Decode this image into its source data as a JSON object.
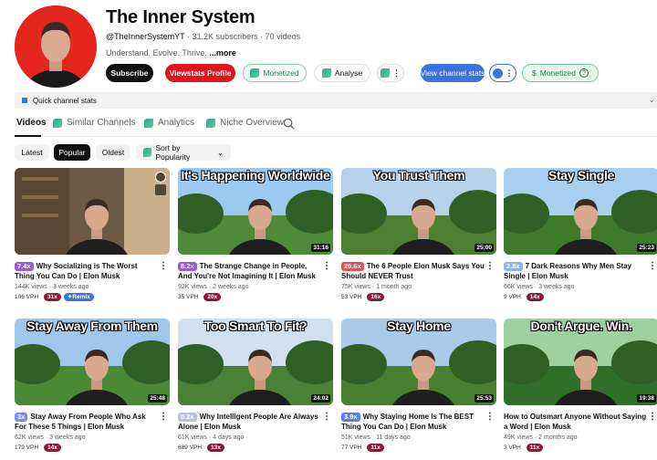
{
  "channel": {
    "title": "The Inner System",
    "handle": "@TheInnerSystemYT",
    "subscribers": "31.2K subscribers",
    "videos": "70 videos",
    "description": "Understand. Evolve. Thrive.",
    "more": "...more",
    "separator": "·"
  },
  "actions": {
    "subscribe": "Subscribe",
    "viewstats_profile": "Viewstats Profile",
    "monetized": "Monetized",
    "analyse": "Analyse",
    "view_channel_stats": "View channel stats",
    "monetized_badge": "Monetized",
    "currency_symbol": "$",
    "help": "?"
  },
  "quick_stats": {
    "label": "Quick channel stats"
  },
  "tabs": [
    {
      "label": "Videos"
    },
    {
      "label": "Similar Channels"
    },
    {
      "label": "Analytics"
    },
    {
      "label": "Niche Overview"
    }
  ],
  "filters": {
    "latest": "Latest",
    "popular": "Popular",
    "oldest": "Oldest",
    "sort": "Sort by Popularity"
  },
  "colors": {
    "brand_red": "#e0151b",
    "accent_blue": "#3a72e0",
    "monetized_green": "#1a7a44",
    "pill_maroon": "#8b1836"
  },
  "videos": [
    {
      "thumb_text": "",
      "duration": "",
      "multiplier": "7.4x",
      "mult_color": "#9b59d6",
      "title": "Why Socializing is The Worst Thing You Can Do | Elon Musk",
      "views": "144K views",
      "age": "3 weeks ago",
      "vph": "106 VPH",
      "pill": "31x",
      "remix": "Remix"
    },
    {
      "thumb_text": "It's Happening Worldwide",
      "duration": "31:16",
      "multiplier": "8.2x",
      "mult_color": "#9b59d6",
      "title": "The Strange Change in People, And You're Not Imagining It | Elon Musk",
      "views": "92K views",
      "age": "2 weeks ago",
      "vph": "35 VPH",
      "pill": "20x",
      "remix": ""
    },
    {
      "thumb_text": "You Trust Them",
      "duration": "25:00",
      "multiplier": "20.6x",
      "mult_color": "#e0505c",
      "title": "The 6 People Elon Musk Says You Should NEVER Trust",
      "views": "75K views",
      "age": "1 month ago",
      "vph": "53 VPH",
      "pill": "16x",
      "remix": ""
    },
    {
      "thumb_text": "Stay Single",
      "duration": "25:23",
      "multiplier": "2.8x",
      "mult_color": "#8fb3ee",
      "title": "7 Dark Reasons Why Men Stay Single | Elon Musk",
      "views": "66K views",
      "age": "3 weeks ago",
      "vph": "9 VPH",
      "pill": "14x",
      "remix": ""
    },
    {
      "thumb_text": "Stay Away From Them",
      "duration": "25:48",
      "multiplier": "3x",
      "mult_color": "#7d8ce8",
      "title": "Stay Away From People Who Ask For These 5 Things | Elon Musk",
      "views": "62K views",
      "age": "3 weeks ago",
      "vph": "179 VPH",
      "pill": "14x",
      "remix": ""
    },
    {
      "thumb_text": "Too Smart To Fit?",
      "duration": "24:02",
      "multiplier": "0.2x",
      "mult_color": "#b9c3d3",
      "title": "Why Intelligent People Are Always Alone | Elon Musk",
      "views": "61K views",
      "age": "4 days ago",
      "vph": "689 VPH",
      "pill": "13x",
      "remix": ""
    },
    {
      "thumb_text": "Stay Home",
      "duration": "25:53",
      "multiplier": "3.9x",
      "mult_color": "#5b7ce0",
      "title": "Why Staying Home Is The BEST Thing You Can Do | Elon Musk",
      "views": "51K views",
      "age": "11 days ago",
      "vph": "77 VPH",
      "pill": "11x",
      "remix": ""
    },
    {
      "thumb_text": "Don't Argue. Win.",
      "duration": "19:38",
      "multiplier": "",
      "mult_color": "#ffffff",
      "title": "How to Outsmart Anyone Without Saying a Word | Elon Musk",
      "views": "49K views",
      "age": "2 months ago",
      "vph": "3 VPH",
      "pill": "11x",
      "remix": ""
    }
  ]
}
